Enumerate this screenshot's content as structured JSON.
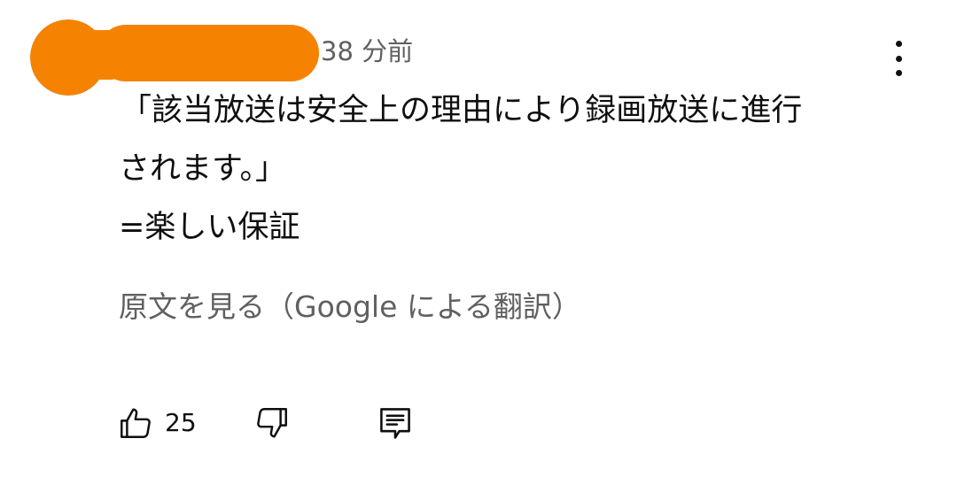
{
  "comment": {
    "author": {
      "redacted": true
    },
    "timestamp": "38 分前",
    "text_lines": [
      "「該当放送は安全上の理由により録画放送に進行",
      "されます。」",
      "=楽しい保証"
    ],
    "translate_link": "原文を見る（Google による翻訳）",
    "actions": {
      "like_count": "25",
      "like_icon": "thumbs-up-icon",
      "dislike_icon": "thumbs-down-icon",
      "reply_icon": "reply-comment-icon"
    },
    "menu_icon": "more-vertical-icon"
  },
  "colors": {
    "redaction": "#f58200",
    "primary_text": "#0f0f0f",
    "secondary_text": "#606060",
    "background": "#ffffff"
  }
}
